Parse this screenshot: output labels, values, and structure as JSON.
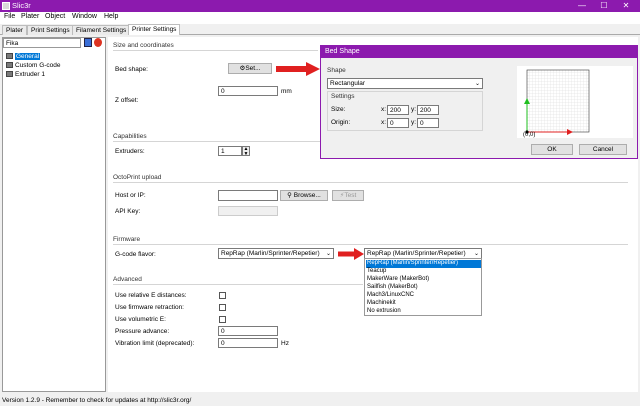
{
  "window": {
    "title": "Slic3r",
    "min_label": "—",
    "max_label": "☐",
    "close_label": "✕"
  },
  "menu": [
    "File",
    "Plater",
    "Object",
    "Window",
    "Help"
  ],
  "tabs": [
    {
      "label": "Plater",
      "active": false
    },
    {
      "label": "Print Settings",
      "active": false
    },
    {
      "label": "Filament Settings",
      "active": false
    },
    {
      "label": "Printer Settings",
      "active": true
    }
  ],
  "sidebar": {
    "preset": "Fika",
    "items": [
      {
        "label": "General",
        "selected": true
      },
      {
        "label": "Custom G-code",
        "selected": false
      },
      {
        "label": "Extruder 1",
        "selected": false
      }
    ]
  },
  "size": {
    "title": "Size and coordinates",
    "bed_shape_label": "Bed shape:",
    "set_button": "Set...",
    "z_offset_label": "Z offset:",
    "z_offset_value": "0",
    "z_offset_unit": "mm"
  },
  "capabilities": {
    "title": "Capabilities",
    "extruders_label": "Extruders:",
    "extruders_value": "1"
  },
  "octoprint": {
    "title": "OctoPrint upload",
    "host_label": "Host or IP:",
    "browse_button": "Browse...",
    "test_button": "Test",
    "apikey_label": "API Key:"
  },
  "firmware": {
    "title": "Firmware",
    "gcode_flavor_label": "G-code flavor:",
    "gcode_flavor_value": "RepRap (Marlin/Sprinter/Repetier)",
    "dropdown_value": "RepRap (Marlin/Sprinter/Repetier)",
    "options": [
      "RepRap (Marlin/Sprinter/Repetier)",
      "Teacup",
      "MakerWare (MakerBot)",
      "Sailfish (MakerBot)",
      "Mach3/LinuxCNC",
      "Machinekit",
      "No extrusion"
    ]
  },
  "advanced": {
    "title": "Advanced",
    "relative_e": "Use relative E distances:",
    "firmware_retraction": "Use firmware retraction:",
    "volumetric_e": "Use volumetric E:",
    "pressure_advance": "Pressure advance:",
    "pressure_advance_value": "0",
    "vibration_limit": "Vibration limit (deprecated):",
    "vibration_limit_value": "0",
    "vibration_unit": "Hz"
  },
  "dialog": {
    "title": "Bed Shape",
    "shape_group": "Shape",
    "shape_value": "Rectangular",
    "settings_group": "Settings",
    "size_label": "Size:",
    "size_x": "200",
    "size_y": "200",
    "origin_label": "Origin:",
    "origin_x": "0",
    "origin_y": "0",
    "x_label": "x:",
    "y_label": "y:",
    "origin_mark": "(0,0)",
    "ok_button": "OK",
    "cancel_button": "Cancel"
  },
  "status": "Version 1.2.9 - Remember to check for updates at http://slic3r.org/",
  "colors": {
    "accent": "#8c1aae",
    "arrow": "#e02020",
    "selection": "#0078d7"
  }
}
